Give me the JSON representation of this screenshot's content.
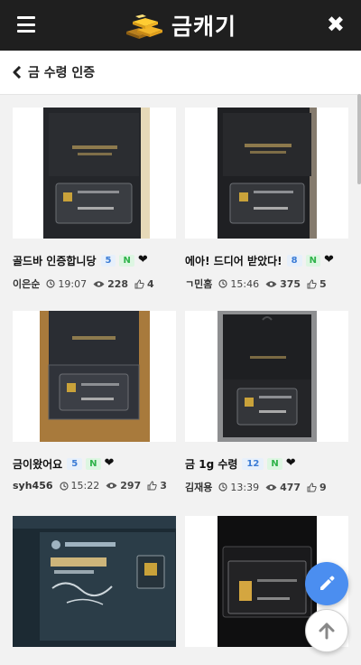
{
  "header": {
    "brand": "금캐기",
    "menu_icon": "hamburger-menu-icon",
    "close_icon": "close-icon",
    "logo_icon": "gold-bars-logo-icon"
  },
  "subheader": {
    "title": "금 수령 인증",
    "back_icon": "chevron-left-icon"
  },
  "posts": [
    {
      "title": "골드바 인증합니당",
      "count": "5",
      "new_badge": "N",
      "author": "이은순",
      "time": "19:07",
      "views": "228",
      "likes": "4"
    },
    {
      "title": "에아! 드디어 받았다!",
      "count": "8",
      "new_badge": "N",
      "author": "ㄱ민홈",
      "time": "15:46",
      "views": "375",
      "likes": "5"
    },
    {
      "title": "금이왔어요",
      "count": "5",
      "new_badge": "N",
      "author": "syh456",
      "time": "15:22",
      "views": "297",
      "likes": "3"
    },
    {
      "title": "금 1g 수령",
      "count": "12",
      "new_badge": "N",
      "author": "김재용",
      "time": "13:39",
      "views": "477",
      "likes": "9"
    },
    {
      "title": "",
      "count": "",
      "new_badge": "",
      "author": "",
      "time": "",
      "views": "",
      "likes": ""
    },
    {
      "title": "",
      "count": "",
      "new_badge": "",
      "author": "",
      "time": "",
      "views": "",
      "likes": ""
    }
  ],
  "fab": {
    "edit_icon": "pencil-icon",
    "top_icon": "arrow-up-icon"
  }
}
